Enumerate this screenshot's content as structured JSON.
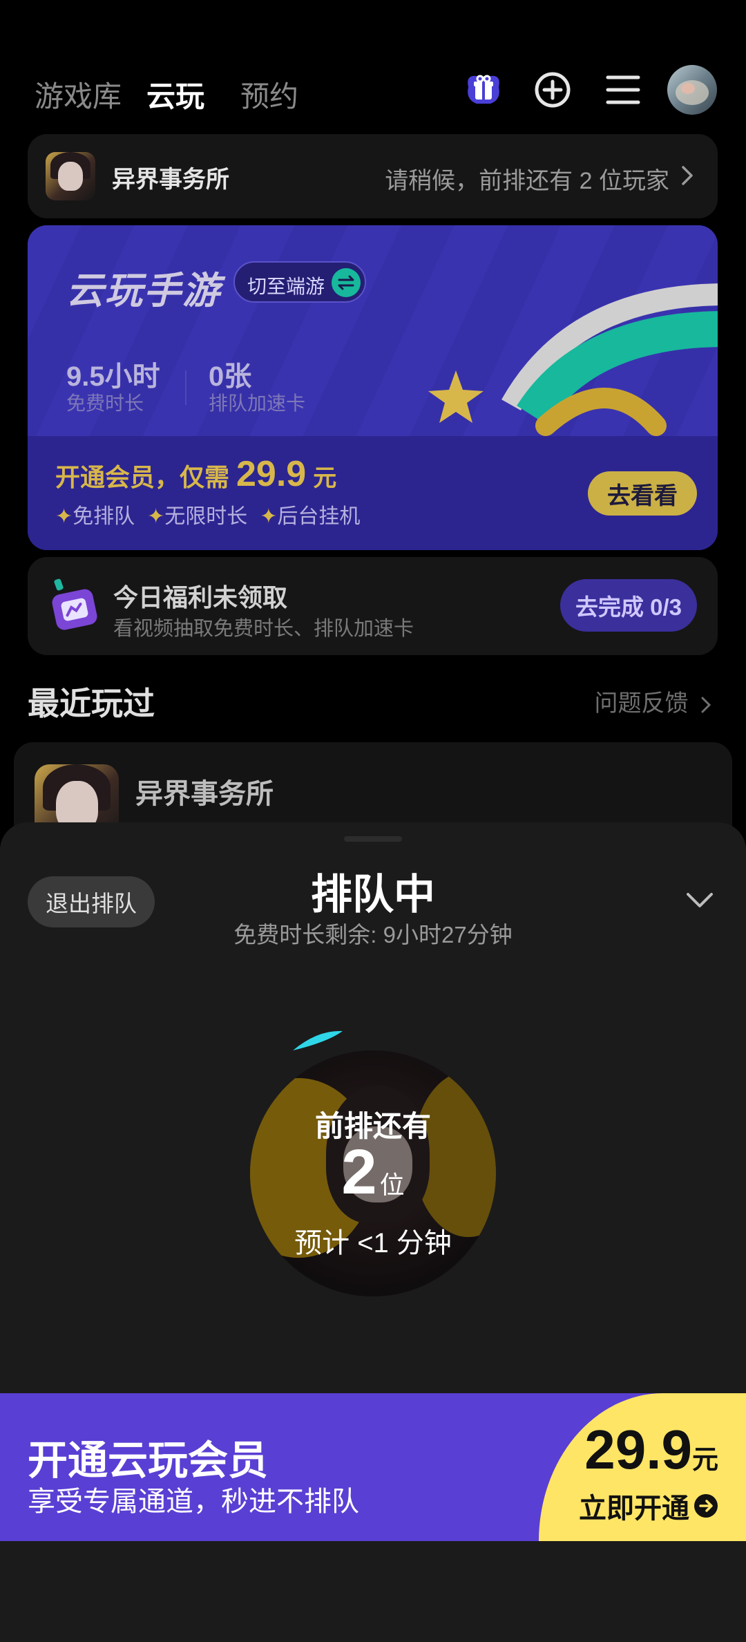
{
  "nav": {
    "tabs": [
      "游戏库",
      "云玩",
      "预约"
    ],
    "active_tab": 1,
    "icons": [
      "gift-icon",
      "add-circle-icon",
      "menu-icon",
      "avatar"
    ]
  },
  "queue_banner": {
    "game": "异界事务所",
    "status": "请稍候，前排还有 2 位玩家"
  },
  "promo": {
    "title": "云玩手游",
    "switch_label": "切至端游",
    "stats": [
      {
        "value": "9.5小时",
        "label": "免费时长"
      },
      {
        "value": "0张",
        "label": "排队加速卡"
      }
    ],
    "vip_prefix": "开通会员，仅需",
    "vip_price": "29.9",
    "vip_unit": "元",
    "perks": [
      "免排队",
      "无限时长",
      "后台挂机"
    ],
    "cta": "去看看"
  },
  "welfare": {
    "title": "今日福利未领取",
    "subtitle": "看视频抽取免费时长、排队加速卡",
    "cta": "去完成 0/3"
  },
  "recent": {
    "title": "最近玩过",
    "feedback": "问题反馈",
    "game": "异界事务所"
  },
  "sheet": {
    "exit_label": "退出排队",
    "title": "排队中",
    "subtitle": "免费时长剩余: 9小时27分钟",
    "ahead_label": "前排还有",
    "ahead_count": "2",
    "ahead_unit": "位",
    "eta": "预计 <1 分钟"
  },
  "vip_bar": {
    "title": "开通云玩会员",
    "subtitle": "享受专属通道，秒进不排队",
    "price": "29.9",
    "unit": "元",
    "cta": "立即开通"
  },
  "colors": {
    "accent_purple": "#5a3fd4",
    "accent_yellow": "#ffe566",
    "promo_bg": "#2f2a9a",
    "teal": "#1fb7a0",
    "gold": "#d8b74a"
  }
}
